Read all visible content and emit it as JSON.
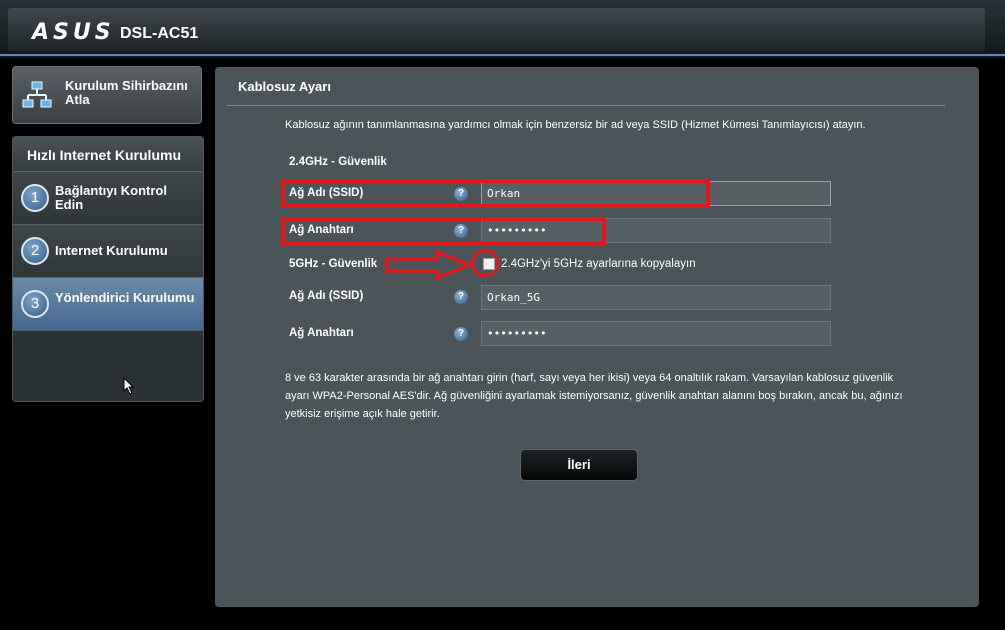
{
  "header": {
    "brand": "ASUS",
    "model": "DSL-AC51"
  },
  "sidebar": {
    "wizard_button_label": "Kurulum Sihirbazını Atla",
    "section_title": "Hızlı Internet Kurulumu",
    "steps": [
      {
        "number": "1",
        "label": "Bağlantıyı Kontrol Edin"
      },
      {
        "number": "2",
        "label": "Internet Kurulumu"
      },
      {
        "number": "3",
        "label": "Yönlendirici Kurulumu"
      }
    ]
  },
  "main": {
    "title": "Kablosuz Ayarı",
    "description": "Kablosuz ağının tanımlanmasına yardımcı olmak için benzersiz bir ad veya SSID (Hizmet Kümesi Tanımlayıcısı) atayın.",
    "band24": {
      "heading": "2.4GHz - Güvenlik",
      "ssid_label": "Ağ Adı (SSID)",
      "ssid_value": "Orkan",
      "key_label": "Ağ Anahtarı",
      "key_value": "•••••••••"
    },
    "band5": {
      "heading": "5GHz - Güvenlik",
      "copy_label": "2.4GHz'yi 5GHz ayarlarına kopyalayın",
      "ssid_label": "Ağ Adı (SSID)",
      "ssid_value": "Orkan_5G",
      "key_label": "Ağ Anahtarı",
      "key_value": "•••••••••"
    },
    "help_glyph": "?",
    "hint": "8 ve 63 karakter arasında bir ağ anahtarı girin (harf, sayı veya her ikisi) veya 64 onaltılık rakam. Varsayılan kablosuz güvenlik ayarı WPA2-Personal AES'dir. Ağ güvenliğini ayarlamak istemiyorsanız, güvenlik anahtarı alanını boş bırakın, ancak bu, ağınızı yetkisiz erişime açık hale getirir.",
    "next_label": "İleri"
  },
  "colors": {
    "annotation_red": "#e01a1a",
    "panel_bg": "#4b5459",
    "active_step": "#45698e"
  }
}
